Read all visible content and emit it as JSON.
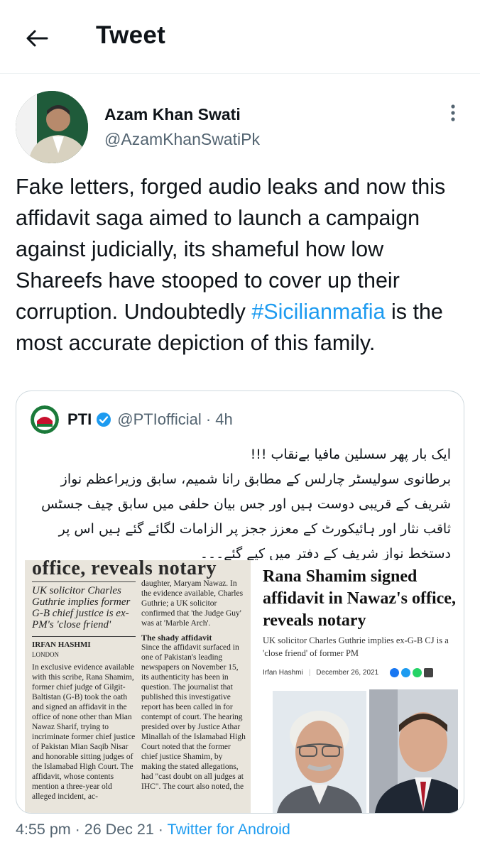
{
  "header": {
    "title": "Tweet"
  },
  "tweet": {
    "author_name": "Azam Khan Swati",
    "author_handle": "@AzamKhanSwatiPk",
    "text_before": "Fake letters, forged audio leaks and now this affidavit saga aimed to launch a campaign against judicially, its shameful how low Shareefs have stooped to cover up their corruption. Undoubtedly ",
    "hashtag": "#Sicilianmafia",
    "text_after": " is the most accurate depiction of this family.",
    "timestamp": "4:55 pm · 26 Dec 21 · ",
    "source": "Twitter for Android"
  },
  "quoted": {
    "name": "PTI",
    "handle": "@PTIofficial · 4h",
    "urdu_lines": [
      "ایک بار پھر سسلین مافیا بےنقاب !!!",
      "برطانوی سولیسٹر چارلس کے مطابق رانا شمیم، سابق وزیراعظم نواز",
      "شریف کے قریبی دوست ہیں اور جس بیان حلفی میں سابق چیف جسٹس",
      "ثاقب نثار اور ہائیکورٹ کے معزز ججز پر الزامات لگائے گئے ہیں اس پر",
      "دستخط نواز شریف کے دفتر میں کیے گئے۔۔۔"
    ]
  },
  "media": {
    "left_head": "office, reveals notary",
    "left_pull": "UK solicitor Charles Guthrie implies former G-B chief justice is ex-PM's 'close friend'",
    "left_byline": "IRFAN HASHMI",
    "left_dateline": "LONDON",
    "left_col1": "In exclusive evidence available with this scribe, Rana Shamim, former chief judge of Gilgit-Baltistan (G-B) took the oath and signed an affidavit in the office of none other than Mian Nawaz Sharif, trying to incriminate former chief justice of Pakistan Mian Saqib Nisar and honorable sitting judges of the Islamabad High Court. The affidavit, whose contents mention a three-year old alleged incident, ac-",
    "left_col2a": "daughter, Maryam Nawaz. In the evidence available, Charles Guthrie; a UK solicitor confirmed that 'the Judge Guy' was at 'Marble Arch'.",
    "left_subhead": "The shady affidavit",
    "left_col2b": "Since the affidavit surfaced in one of Pakistan's leading newspapers on November 15, its authenticity has been in question. The journalist that published this investigative report has been called in for contempt of court. The hearing presided over by Justice Athar Minallah of the Islamabad High Court noted that the former chief justice Shamim, by making the stated allegations, had \"cast doubt on all judges at IHC\". The court also noted, the",
    "right_title": "Rana Shamim signed affidavit in Nawaz's office, reveals notary",
    "right_sub": "UK solicitor Charles Guthrie implies ex-G-B CJ is a 'close friend' of former PM",
    "right_author": "Irfan Hashmi",
    "right_date": "December 26, 2021"
  }
}
